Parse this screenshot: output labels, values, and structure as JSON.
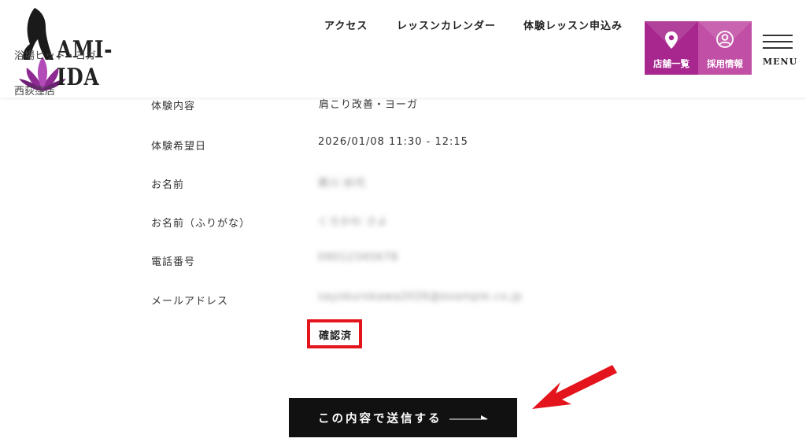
{
  "header": {
    "logo_name": "AMI-IDA",
    "tagline": "浴場ヒット・ヨガ",
    "branch": "西荻窪店",
    "nav": [
      "アクセス",
      "レッスンカレンダー",
      "体験レッスン申込み"
    ],
    "store_list_label": "店舗一覧",
    "recruit_label": "採用情報",
    "menu_label": "MENU",
    "colors": {
      "store_tile": "#a8278f",
      "recruit_tile": "#c24fa6"
    }
  },
  "form": {
    "rows": [
      {
        "label": "体験内容",
        "value": "肩こり改善・ヨーガ"
      },
      {
        "label": "体験希望日",
        "value": "2026/01/08 11:30 - 12:15"
      },
      {
        "label": "お名前",
        "value": "黒川 紗代"
      },
      {
        "label": "お名前（ふりがな）",
        "value": "くろかわ さよ"
      },
      {
        "label": "電話番号",
        "value": "09012345678"
      },
      {
        "label": "メールアドレス",
        "value": "sayokurokawa2026@example.co.jp"
      }
    ],
    "confirm_status": "確認済",
    "submit_label": "この内容で送信する"
  },
  "annotation": {
    "highlight_color": "#e4141c"
  }
}
